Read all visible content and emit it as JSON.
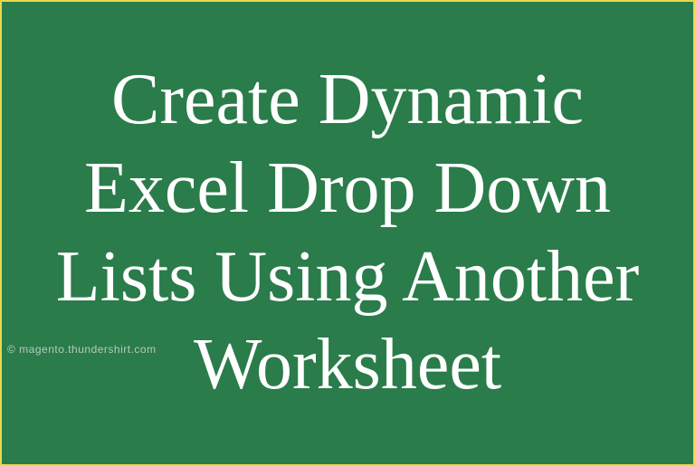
{
  "title": "Create Dynamic Excel Drop Down Lists Using Another Worksheet",
  "attribution": "© magento.thundershirt.com"
}
